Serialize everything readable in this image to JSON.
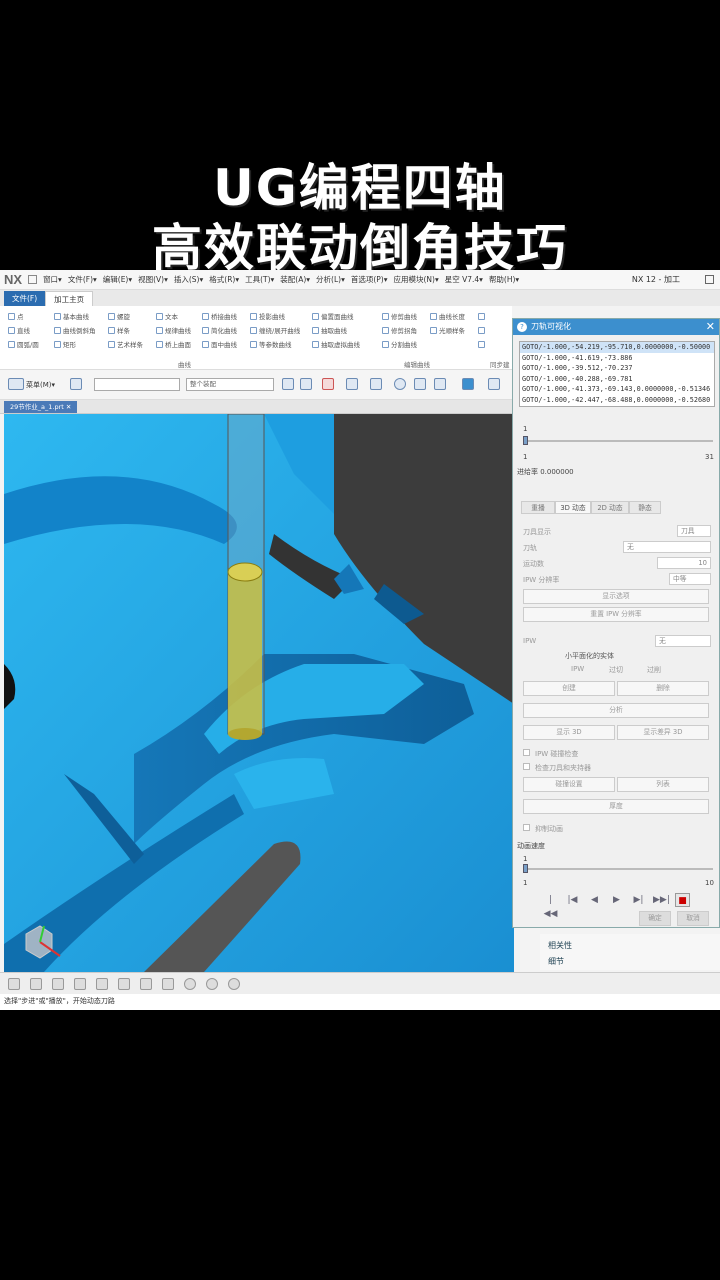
{
  "overlay": {
    "title_line1": "UG编程四轴",
    "title_line2": "高效联动倒角技巧"
  },
  "window": {
    "logo": "NX",
    "app_title": "NX 12 - 加工",
    "menu": [
      "窗口▾",
      "文件(F)▾",
      "编辑(E)▾",
      "视图(V)▾",
      "插入(S)▾",
      "格式(R)▾",
      "工具(T)▾",
      "装配(A)▾",
      "分析(L)▾",
      "首选项(P)▾",
      "应用模块(N)▾",
      "星空 V7.4▾",
      "帮助(H)▾"
    ]
  },
  "tabs": {
    "file": "文件(F)",
    "home": "加工主页"
  },
  "ribbon": {
    "col1": [
      "点",
      "直线",
      "圆弧/圆"
    ],
    "col2": [
      "基本曲线",
      "曲线倒斜角",
      "矩形"
    ],
    "col3": [
      "螺旋",
      "样条",
      "艺术样条"
    ],
    "col4": [
      "文本",
      "规律曲线",
      "桥上曲面"
    ],
    "col5": [
      "桥接曲线",
      "简化曲线",
      "面中曲线"
    ],
    "col6": [
      "投影曲线",
      "缠绕/展开曲线",
      "等参数曲线"
    ],
    "col7": [
      "偏置面曲线",
      "抽取曲线",
      "抽取虚拟曲线"
    ],
    "col8": [
      "修剪曲线",
      "修剪拐角",
      "分割曲线"
    ],
    "col9": [
      "曲线长度",
      "光顺样条",
      ""
    ],
    "group_curve": "曲线",
    "group_edit": "编辑曲线",
    "group_sync": "同步建模"
  },
  "toolbar": {
    "menu_label": "菜单(M)▾",
    "filter_placeholder": "整个装配"
  },
  "document": {
    "tab_name": "29节作业_a_1.prt"
  },
  "dialog": {
    "title": "刀轨可视化",
    "goto_lines": [
      "GOTO/-1.000,-54.219,-95.710,0.0000000,-0.50000",
      "GOTO/-1.000,-41.619,-73.886",
      "GOTO/-1.000,-39.512,-70.237",
      "GOTO/-1.000,-40.288,-69.781",
      "GOTO/-1.000,-41.373,-69.143,0.0000000,-0.51346",
      "GOTO/-1.000,-42.447,-68.488,0.0000000,-0.52680"
    ],
    "slider_top": "1",
    "slider_min": "1",
    "slider_max": "31",
    "progress_label": "进给率 0.000000",
    "tabs": [
      "重播",
      "3D 动态",
      "2D 动态",
      "静态"
    ],
    "tool_display_label": "刀具显示",
    "tool_display_value": "刀具",
    "toolpath_label": "刀轨",
    "toolpath_value": "无",
    "motion_count_label": "运动数",
    "motion_count_value": "10",
    "ipw_res_label": "IPW 分辨率",
    "ipw_res_value": "中等",
    "btn_display_options": "显示选项",
    "btn_reset_ipw": "重置 IPW 分辨率",
    "ipw_label": "IPW",
    "ipw_value": "无",
    "faceted_header": "小平面化的实体",
    "radio_ipw": "IPW",
    "radio_overcut": "过切",
    "radio_gouge": "过削",
    "btn_create": "创建",
    "btn_delete": "删除",
    "btn_analyze": "分析",
    "btn_show3d": "显示 3D",
    "btn_show_diff3d": "显示差异 3D",
    "chk_ipw_collision": "IPW 碰撞检查",
    "chk_check_holder": "检查刀具和夹持器",
    "btn_collision_settings": "碰撞设置",
    "btn_list": "列表",
    "btn_thickness": "厚度",
    "chk_abort": "抑制动画",
    "anim_speed_label": "动画速度",
    "speed_top": "1",
    "speed_min": "1",
    "speed_max": "10",
    "playback": [
      "|◀◀",
      "|◀",
      "◀",
      "▶",
      "▶|",
      "▶▶|",
      "■"
    ],
    "btn_ok": "确定",
    "btn_cancel": "取消"
  },
  "sidepanel": {
    "item1": "相关性",
    "item2": "细节"
  },
  "status": {
    "text": "选择\"步进\"或\"播放\"，开始动态刀路"
  },
  "colors": {
    "accent": "#3c8fce",
    "part": "#1fa6e6",
    "tool": "#d4c23a"
  }
}
